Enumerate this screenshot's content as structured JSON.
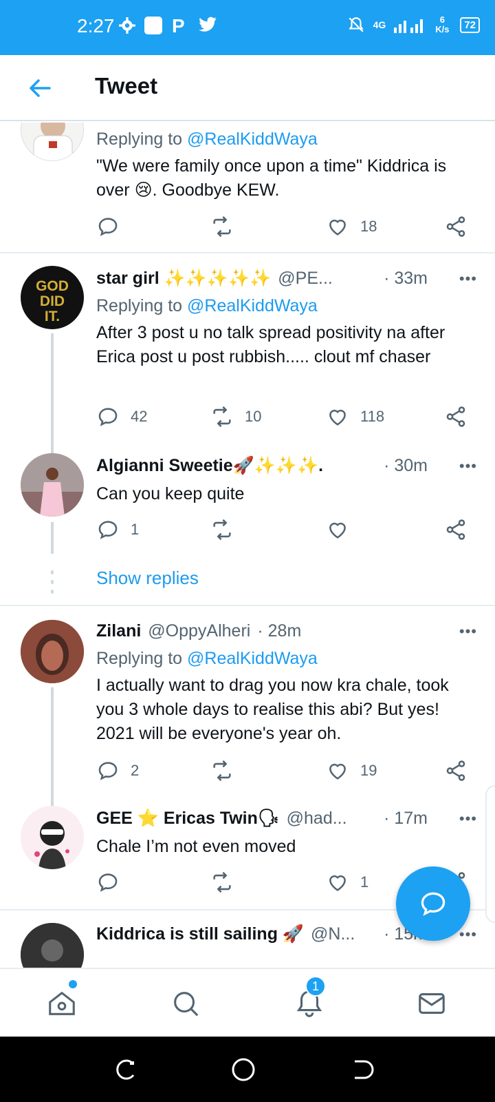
{
  "status_bar": {
    "time": "2:27",
    "network": "4G",
    "speed": "6 K/s",
    "battery": "72"
  },
  "header": {
    "title": "Tweet"
  },
  "tweets": [
    {
      "replying_label": "Replying to",
      "mention": "@RealKiddWaya",
      "text": "\"We were family once upon a time\" Kiddrica is over 😢.  Goodbye KEW.",
      "likes": "18"
    },
    {
      "name": "star girl ✨✨✨✨✨",
      "handle": "@PE...",
      "time": "· 33m",
      "replying_label": "Replying to",
      "mention": "@RealKiddWaya",
      "text": "After 3 post u no talk spread positivity na after Erica post u post rubbish..... clout mf chaser",
      "replies": "42",
      "retweets": "10",
      "likes": "118"
    },
    {
      "name": "Algianni Sweetie🚀✨✨✨.",
      "time": "· 30m",
      "text": "Can you keep quite",
      "replies": "1"
    },
    {
      "name": "Zilani",
      "handle": "@OppyAlheri",
      "time": "· 28m",
      "replying_label": "Replying to",
      "mention": "@RealKiddWaya",
      "text": "I actually want to drag you now kra chale, took you 3 whole days to realise this abi? But yes! 2021 will be everyone's year oh.",
      "replies": "2",
      "likes": "19"
    },
    {
      "name": "GEE ⭐ Ericas Twin🗣",
      "handle": "@had...",
      "time": "· 17m",
      "text": "Chale I’m not even moved",
      "likes": "1"
    },
    {
      "name": "Kiddrica is still sailing 🚀",
      "handle": "@N...",
      "time": "· 15m"
    }
  ],
  "show_replies": "Show replies",
  "more_glyph": "•••",
  "bottom_nav": {
    "notifications_badge": "1"
  },
  "colors": {
    "brand_blue": "#1da1f2",
    "link_blue": "#1d9bf0",
    "muted": "#536471"
  }
}
